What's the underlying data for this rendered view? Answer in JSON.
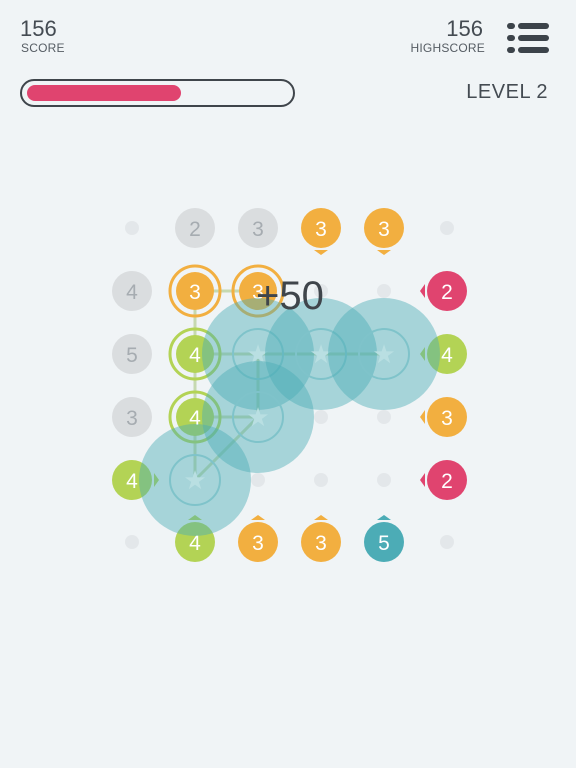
{
  "hud": {
    "score_value": "156",
    "score_label": "SCORE",
    "highscore_value": "156",
    "highscore_label": "HIGHSCORE",
    "level_label": "LEVEL 2",
    "progress": 0.59
  },
  "menu_icon": "list-menu-icon",
  "popup_text": "+50",
  "colors": {
    "background": "#f0f4f6",
    "gray": "#dadddf",
    "gray_text": "#a6acb1",
    "orange": "#f2af40",
    "green": "#b3d355",
    "pink": "#e0446f",
    "teal": "#4cacb6",
    "progress": "#e0446f"
  },
  "board": {
    "top_row": [
      {
        "value": "",
        "color": "dot"
      },
      {
        "value": "2",
        "color": "gray"
      },
      {
        "value": "3",
        "color": "gray"
      },
      {
        "value": "3",
        "color": "orange",
        "pointer": "down"
      },
      {
        "value": "3",
        "color": "orange",
        "pointer": "down"
      },
      {
        "value": "",
        "color": "dot"
      }
    ],
    "left_column": [
      {
        "value": "4",
        "color": "gray"
      },
      {
        "value": "5",
        "color": "gray"
      },
      {
        "value": "3",
        "color": "gray"
      },
      {
        "value": "4",
        "color": "green",
        "pointer": "right"
      }
    ],
    "right_column": [
      {
        "value": "2",
        "color": "pink",
        "pointer": "left"
      },
      {
        "value": "4",
        "color": "green",
        "pointer": "left"
      },
      {
        "value": "3",
        "color": "orange",
        "pointer": "left"
      },
      {
        "value": "2",
        "color": "pink",
        "pointer": "left"
      }
    ],
    "bottom_row": [
      {
        "value": "",
        "color": "dot"
      },
      {
        "value": "4",
        "color": "green",
        "pointer": "up"
      },
      {
        "value": "3",
        "color": "orange",
        "pointer": "up"
      },
      {
        "value": "3",
        "color": "orange",
        "pointer": "up"
      },
      {
        "value": "5",
        "color": "teal",
        "pointer": "up"
      },
      {
        "value": "",
        "color": "dot"
      }
    ],
    "inner_grid": [
      [
        {
          "value": "3",
          "kind": "ring",
          "color": "orange"
        },
        {
          "value": "3",
          "kind": "ring",
          "color": "orange"
        },
        {
          "kind": "dot"
        },
        {
          "kind": "dot"
        }
      ],
      [
        {
          "value": "4",
          "kind": "ring",
          "color": "green"
        },
        {
          "value": "★",
          "kind": "star"
        },
        {
          "value": "★",
          "kind": "star"
        },
        {
          "value": "★",
          "kind": "star"
        }
      ],
      [
        {
          "value": "4",
          "kind": "ring",
          "color": "green"
        },
        {
          "value": "★",
          "kind": "star"
        },
        {
          "kind": "dot"
        },
        {
          "kind": "dot"
        }
      ],
      [
        {
          "value": "★",
          "kind": "star"
        },
        {
          "kind": "dot"
        },
        {
          "kind": "dot"
        },
        {
          "kind": "dot"
        }
      ]
    ]
  }
}
